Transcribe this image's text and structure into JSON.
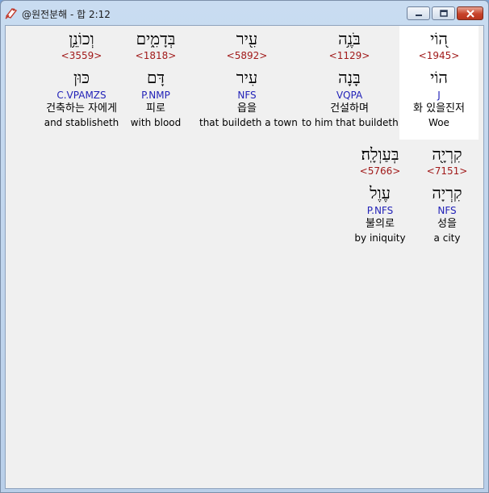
{
  "window": {
    "title": "@원전분해 - 합 2:12",
    "controls": {
      "minimize_icon": "minimize-icon",
      "maximize_icon": "maximize-icon",
      "close_icon": "close-icon"
    },
    "accent_close": "#c7432a"
  },
  "colors": {
    "strong": "#a11a1a",
    "morph": "#2323b8",
    "highlight_bg": "#ffffff",
    "client_bg": "#f0f0f0"
  },
  "lines": [
    {
      "words": [
        {
          "hebrew": "ה֭וֹי",
          "strong": "<1945>",
          "lemma": "הוֹי",
          "morph": "J",
          "korean": "화 있을진저",
          "english": "Woe",
          "highlight": true
        },
        {
          "hebrew": "בֹּנֶ֥ה",
          "strong": "<1129>",
          "lemma": "בָּנָה",
          "morph": "VQPA",
          "korean": "건설하며",
          "english": "to him that buildeth",
          "highlight": false
        },
        {
          "hebrew": "עִ֖יר",
          "strong": "<5892>",
          "lemma": "עִיר",
          "morph": "NFS",
          "korean": "읍을",
          "english": "that buildeth a town",
          "highlight": false
        },
        {
          "hebrew": "בְּדָמִ֑ים",
          "strong": "<1818>",
          "lemma": "דָּם",
          "morph": "P.NMP",
          "korean": "피로",
          "english": "with blood",
          "highlight": false
        },
        {
          "hebrew": "וְכוֹנֵ֥ן",
          "strong": "<3559>",
          "lemma": "כּוּן",
          "morph": "C.VPAMZS",
          "korean": "건축하는 자에게",
          "english": "and stablisheth",
          "highlight": false
        }
      ]
    },
    {
      "words": [
        {
          "hebrew": "קִרְיָ֖ה",
          "strong": "<7151>",
          "lemma": "קִרְיָה",
          "morph": "NFS",
          "korean": "성을",
          "english": "a city",
          "highlight": false
        },
        {
          "hebrew": "בְּעַוְלָֽה׃",
          "strong": "<5766>",
          "lemma": "עֶוֶל",
          "morph": "P.NFS",
          "korean": "불의로",
          "english": "by iniquity",
          "highlight": false
        }
      ]
    }
  ]
}
